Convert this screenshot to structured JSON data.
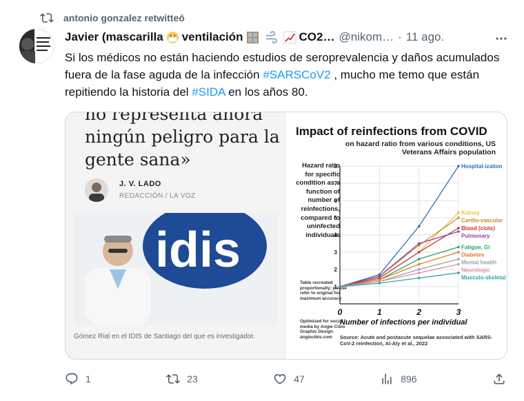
{
  "retweet": {
    "label": "antonio gonzalez retwitteó"
  },
  "author": {
    "name": "Javier (mascarilla",
    "name_mid": "ventilación",
    "name_tail": "CO2…",
    "handle": "@nikom…",
    "separator": "·",
    "time": "11 ago."
  },
  "tweet": {
    "text_1": "Si los médicos no están haciendo estudios de seroprevalencia y daños acumulados fuera de la fase aguda de la infección ",
    "hashtag_1": "#SARSCoV2",
    "text_2": " , mucho me temo que están repitiendo la historia del ",
    "hashtag_2": "#SIDA",
    "text_3": " en los años 80."
  },
  "article": {
    "headline": "no representa ahora ningún peligro para la gente sana»",
    "byline_name": "J. V. LADO",
    "byline_role": "REDACCIÓN / LA VOZ",
    "logo_text": "idis",
    "caption": "Gómez Rial en el IDIS de Santiago del que es investigador."
  },
  "chart_text": {
    "side_note": "Table recreated proportionally; please refer to original for maximum accuracy",
    "credit": "Optimized for social media by Angie Cibis Graphic Design angiecibis.com",
    "source": "Source: Acute and postacute sequelae associated with SARS-CoV-2 reinfection, Al-Aly et al., 2022"
  },
  "chart_data": {
    "type": "line",
    "title": "Impact of reinfections from COVID",
    "subtitle": "on hazard ratio from various conditions, US Veterans Affairs population",
    "ylabel": "Hazard ratio for specific condition as a function of number of reinfections, compared to uninfected individuals",
    "xlabel": "Number of infections per individual",
    "x": [
      0,
      1,
      2,
      3
    ],
    "xlim": [
      0,
      3
    ],
    "ylim": [
      0,
      8
    ],
    "yticks": [
      1,
      2,
      3,
      4,
      5,
      6,
      7,
      8
    ],
    "xticks": [
      0,
      1,
      2,
      3
    ],
    "grid": true,
    "series": [
      {
        "name": "Hospital-ization",
        "color": "#2e6fb0",
        "values": [
          1,
          1.7,
          4.5,
          8.0
        ]
      },
      {
        "name": "Kidney",
        "color": "#e8c547",
        "values": [
          1,
          1.5,
          3.0,
          5.3
        ]
      },
      {
        "name": "Cardio-vascular",
        "color": "#c98a2b",
        "values": [
          1,
          1.6,
          3.4,
          5.0
        ]
      },
      {
        "name": "Blood (clots)",
        "color": "#c0392b",
        "values": [
          1,
          1.5,
          3.0,
          4.4
        ]
      },
      {
        "name": "Pulmonary",
        "color": "#8e44ad",
        "values": [
          1,
          1.6,
          3.5,
          4.2
        ]
      },
      {
        "name": "Fatigue, GI",
        "color": "#27a36b",
        "values": [
          1,
          1.4,
          2.6,
          3.3
        ]
      },
      {
        "name": "Diabetes",
        "color": "#e67e22",
        "values": [
          1,
          1.4,
          2.3,
          3.0
        ]
      },
      {
        "name": "Mental health",
        "color": "#95a5a6",
        "values": [
          1,
          1.3,
          2.0,
          2.6
        ]
      },
      {
        "name": "Neurologic",
        "color": "#e08aa5",
        "values": [
          1,
          1.3,
          1.8,
          2.3
        ]
      },
      {
        "name": "Musculo-skeletal",
        "color": "#2aa6a6",
        "values": [
          1,
          1.2,
          1.5,
          1.8
        ]
      }
    ]
  },
  "actions": {
    "replies": "1",
    "retweets": "23",
    "likes": "47",
    "views": "896"
  }
}
